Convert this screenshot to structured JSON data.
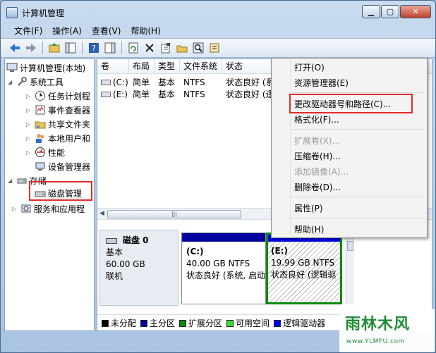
{
  "window": {
    "title": "计算机管理"
  },
  "menu": [
    "文件(F)",
    "操作(A)",
    "查看(V)",
    "帮助(H)"
  ],
  "tree": {
    "root": "计算机管理(本地)",
    "system_tools": "系统工具",
    "task_scheduler": "任务计划程",
    "event_viewer": "事件查看器",
    "shared_folders": "共享文件夹",
    "local_users": "本地用户和",
    "performance": "性能",
    "device_manager": "设备管理器",
    "storage": "存储",
    "disk_management": "磁盘管理",
    "services_apps": "服务和应用程"
  },
  "volume_table": {
    "columns": [
      "卷",
      "布局",
      "类型",
      "文件系统",
      "状态"
    ],
    "rows": [
      {
        "volume": "(C:)",
        "layout": "简单",
        "type": "基本",
        "fs": "NTFS",
        "status": "状态良好 (系"
      },
      {
        "volume": "(E:)",
        "layout": "简单",
        "type": "基本",
        "fs": "NTFS",
        "status": "状态良好 (逻"
      }
    ]
  },
  "disk": {
    "name": "磁盘 0",
    "kind": "基本",
    "size": "60.00 GB",
    "state": "联机",
    "partitions": [
      {
        "label": "(C:)",
        "size": "40.00 GB NTFS",
        "status": "状态良好 (系统, 启动"
      },
      {
        "label": "(E:)",
        "size": "19.99 GB NTFS",
        "status": "状态良好 (逻辑驱"
      }
    ]
  },
  "legend": [
    {
      "label": "未分配",
      "color": "#000000"
    },
    {
      "label": "主分区",
      "color": "#00009c"
    },
    {
      "label": "扩展分区",
      "color": "#0a8a0a"
    },
    {
      "label": "可用空间",
      "color": "#33dd33"
    },
    {
      "label": "逻辑驱动器",
      "color": "#0000ee"
    }
  ],
  "context_menu": {
    "open": "打开(O)",
    "explorer": "资源管理器(E)",
    "change_letter": "更改驱动器号和路径(C)...",
    "format": "格式化(F)...",
    "extend": "扩展卷(X)...",
    "shrink": "压缩卷(H)...",
    "add_mirror": "添加镜像(A)...",
    "delete": "删除卷(D)...",
    "properties": "属性(P)",
    "help": "帮助(H)"
  },
  "watermark": {
    "main": "雨林木风",
    "sub": "www.YLMFU.com"
  },
  "colors": {
    "highlight": "#e32b2b",
    "primary_partition": "#00009c"
  }
}
